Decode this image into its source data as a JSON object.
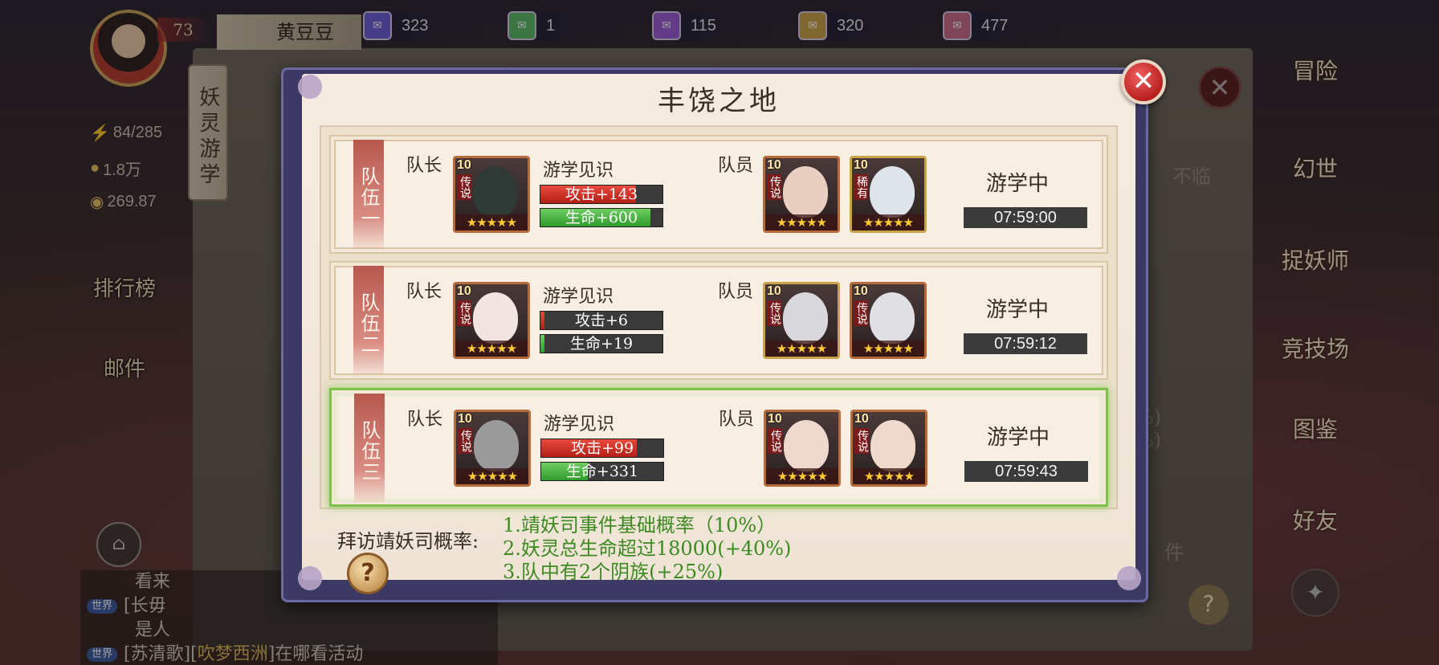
{
  "player": {
    "level": "73",
    "name": "黄豆豆"
  },
  "resources": [
    {
      "icon": "purple-scroll-icon",
      "color": "#6b5bd6",
      "value": "323"
    },
    {
      "icon": "green-scroll-icon",
      "color": "#5bb86a",
      "value": "1"
    },
    {
      "icon": "violet-scroll-icon",
      "color": "#9a5bd6",
      "value": "115"
    },
    {
      "icon": "gold-scroll-icon",
      "color": "#c9a24a",
      "value": "320"
    },
    {
      "icon": "pink-scroll-icon",
      "color": "#c96a8a",
      "value": "477"
    }
  ],
  "side_stats": {
    "stamina": "84/285",
    "gold": "1.8万",
    "coin": "269.87"
  },
  "side_menu": {
    "rank": "排行榜",
    "mail": "邮件"
  },
  "banner": "妖灵游学",
  "right_menu": [
    "冒险",
    "幻世",
    "捉妖师",
    "竞技场",
    "图鉴",
    "好友"
  ],
  "background_text": {
    "not_arrived": "不临",
    "pct1": "%)",
    "pct2": "%)",
    "item": "件"
  },
  "chat": [
    {
      "tag": "",
      "text": "看来"
    },
    {
      "tag": "世界",
      "text": "[长毋"
    },
    {
      "tag": "",
      "text": "是人"
    },
    {
      "tag": "世界",
      "prefix": "[苏清歌][",
      "highlight": "吹梦西洲",
      "suffix": "]在哪看活动"
    }
  ],
  "modal": {
    "title": "丰饶之地",
    "labels": {
      "leader": "队长",
      "member": "队员",
      "knowledge": "游学见识",
      "status": "游学中"
    },
    "teams": [
      {
        "name": "队伍一",
        "leader": {
          "level": "10",
          "rank": "传说",
          "stars": "★★★★★",
          "face": "#2f3a36"
        },
        "attack": "攻击+143",
        "attack_pct": 0.78,
        "hp": "生命+600",
        "hp_pct": 0.9,
        "members": [
          {
            "level": "10",
            "rank": "传说",
            "stars": "★★★★★",
            "face": "#e8cfc2"
          },
          {
            "level": "10",
            "rank": "稀有",
            "stars": "★★★★★",
            "face": "#dfe4ea"
          }
        ],
        "timer": "07:59:00"
      },
      {
        "name": "队伍二",
        "leader": {
          "level": "10",
          "rank": "传说",
          "stars": "★★★★★",
          "face": "#f2e4e0"
        },
        "attack": "攻击+6",
        "attack_pct": 0.03,
        "hp": "生命+19",
        "hp_pct": 0.03,
        "members": [
          {
            "level": "10",
            "rank": "传说",
            "stars": "★★★★★",
            "face": "#d8d8dc"
          },
          {
            "level": "10",
            "rank": "传说",
            "stars": "★★★★★",
            "face": "#e0e0e4"
          }
        ],
        "timer": "07:59:12"
      },
      {
        "name": "队伍三",
        "leader": {
          "level": "10",
          "rank": "传说",
          "stars": "★★★★★",
          "face": "#9a9a9a"
        },
        "attack": "攻击+99",
        "attack_pct": 0.78,
        "hp": "生命+331",
        "hp_pct": 0.38,
        "members": [
          {
            "level": "10",
            "rank": "传说",
            "stars": "★★★★★",
            "face": "#efd8cc"
          },
          {
            "level": "10",
            "rank": "传说",
            "stars": "★★★★★",
            "face": "#efd8cc"
          }
        ],
        "timer": "07:59:43"
      }
    ],
    "probability": {
      "title": "拜访靖妖司概率:",
      "lines": [
        "1.靖妖司事件基础概率（10%）",
        "2.妖灵总生命超过18000(+40%)",
        "3.队中有2个阴族(+25%)"
      ]
    }
  },
  "icons": {
    "close": "✕",
    "help": "?",
    "home": "⌂",
    "compass": "✦"
  }
}
